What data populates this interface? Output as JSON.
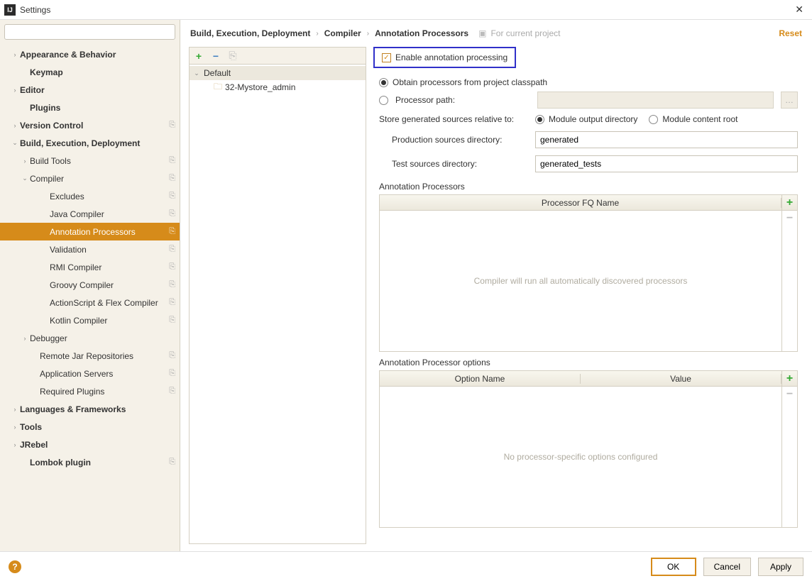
{
  "window": {
    "title": "Settings"
  },
  "search": {
    "placeholder": ""
  },
  "sidebar": [
    {
      "label": "Appearance & Behavior",
      "bold": true,
      "indent": 1,
      "arrow": "›",
      "copy": false
    },
    {
      "label": "Keymap",
      "bold": true,
      "indent": 2,
      "arrow": "",
      "copy": false
    },
    {
      "label": "Editor",
      "bold": true,
      "indent": 1,
      "arrow": "›",
      "copy": false
    },
    {
      "label": "Plugins",
      "bold": true,
      "indent": 2,
      "arrow": "",
      "copy": false
    },
    {
      "label": "Version Control",
      "bold": true,
      "indent": 1,
      "arrow": "›",
      "copy": true
    },
    {
      "label": "Build, Execution, Deployment",
      "bold": true,
      "indent": 1,
      "arrow": "⌄",
      "copy": false
    },
    {
      "label": "Build Tools",
      "bold": false,
      "indent": 2,
      "arrow": "›",
      "copy": true
    },
    {
      "label": "Compiler",
      "bold": false,
      "indent": 2,
      "arrow": "⌄",
      "copy": true
    },
    {
      "label": "Excludes",
      "bold": false,
      "indent": 4,
      "arrow": "",
      "copy": true
    },
    {
      "label": "Java Compiler",
      "bold": false,
      "indent": 4,
      "arrow": "",
      "copy": true
    },
    {
      "label": "Annotation Processors",
      "bold": false,
      "indent": 4,
      "arrow": "",
      "copy": true,
      "selected": true
    },
    {
      "label": "Validation",
      "bold": false,
      "indent": 4,
      "arrow": "",
      "copy": true
    },
    {
      "label": "RMI Compiler",
      "bold": false,
      "indent": 4,
      "arrow": "",
      "copy": true
    },
    {
      "label": "Groovy Compiler",
      "bold": false,
      "indent": 4,
      "arrow": "",
      "copy": true
    },
    {
      "label": "ActionScript & Flex Compiler",
      "bold": false,
      "indent": 4,
      "arrow": "",
      "copy": true
    },
    {
      "label": "Kotlin Compiler",
      "bold": false,
      "indent": 4,
      "arrow": "",
      "copy": true
    },
    {
      "label": "Debugger",
      "bold": false,
      "indent": 2,
      "arrow": "›",
      "copy": false
    },
    {
      "label": "Remote Jar Repositories",
      "bold": false,
      "indent": 3,
      "arrow": "",
      "copy": true
    },
    {
      "label": "Application Servers",
      "bold": false,
      "indent": 3,
      "arrow": "",
      "copy": true
    },
    {
      "label": "Required Plugins",
      "bold": false,
      "indent": 3,
      "arrow": "",
      "copy": true
    },
    {
      "label": "Languages & Frameworks",
      "bold": true,
      "indent": 1,
      "arrow": "›",
      "copy": false
    },
    {
      "label": "Tools",
      "bold": true,
      "indent": 1,
      "arrow": "›",
      "copy": false
    },
    {
      "label": "JRebel",
      "bold": true,
      "indent": 1,
      "arrow": "›",
      "copy": false
    },
    {
      "label": "Lombok plugin",
      "bold": true,
      "indent": 2,
      "arrow": "",
      "copy": true
    }
  ],
  "breadcrumb": {
    "a": "Build, Execution, Deployment",
    "b": "Compiler",
    "c": "Annotation Processors",
    "proj": "For current project",
    "reset": "Reset"
  },
  "profiles": {
    "group": "Default",
    "item": "32-Mystore_admin"
  },
  "form": {
    "enable": "Enable annotation processing",
    "obtain": "Obtain processors from project classpath",
    "procpath": "Processor path:",
    "storeRel": "Store generated sources relative to:",
    "modOut": "Module output directory",
    "modRoot": "Module content root",
    "prodDirLabel": "Production sources directory:",
    "prodDirVal": "generated",
    "testDirLabel": "Test sources directory:",
    "testDirVal": "generated_tests",
    "apSection": "Annotation Processors",
    "apCol": "Processor FQ Name",
    "apEmpty": "Compiler will run all automatically discovered processors",
    "opSection": "Annotation Processor options",
    "opCol1": "Option Name",
    "opCol2": "Value",
    "opEmpty": "No processor-specific options configured"
  },
  "footer": {
    "ok": "OK",
    "cancel": "Cancel",
    "apply": "Apply"
  }
}
